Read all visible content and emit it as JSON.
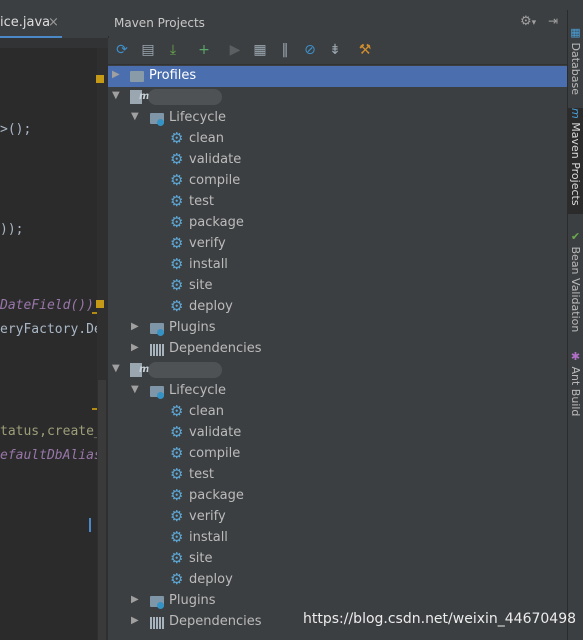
{
  "editor": {
    "tab_label": "ice.java",
    "tab_close": "×",
    "code_lines": [
      {
        "text": ">();",
        "style": "normal"
      },
      {
        "text": "));",
        "style": "normal"
      },
      {
        "text": "DateField())",
        "style": "ital"
      },
      {
        "text": "eryFactory.Der",
        "style": "normal"
      },
      {
        "text": "tatus,create_t",
        "style": "gold"
      },
      {
        "text": "efaultDbAlias)",
        "style": "ital"
      }
    ]
  },
  "panel": {
    "title": "Maven Projects",
    "settings_icon": "⚙",
    "settings_caret": "▾",
    "hide_icon": "⇥"
  },
  "toolbar": [
    {
      "name": "reimport-icon",
      "glyph": "⟳",
      "color": "#3d8fc9"
    },
    {
      "name": "generate-sources-icon",
      "glyph": "▤",
      "color": "#9aa7b0"
    },
    {
      "name": "download-icon",
      "glyph": "⤓",
      "color": "#6aa84f"
    },
    {
      "name": "add-icon",
      "glyph": "+",
      "color": "#59a869"
    },
    {
      "name": "run-icon",
      "glyph": "▶",
      "color": "#5c5f61"
    },
    {
      "name": "run-config-icon",
      "glyph": "▦",
      "color": "#9aa7b0"
    },
    {
      "name": "toggle-offline-icon",
      "glyph": "‖",
      "color": "#9aa7b0"
    },
    {
      "name": "skip-tests-icon",
      "glyph": "⊘",
      "color": "#3d8fc9"
    },
    {
      "name": "collapse-all-icon",
      "glyph": "⇟",
      "color": "#9aa7b0"
    },
    {
      "name": "maven-settings-icon",
      "glyph": "⚒",
      "color": "#d08f2d"
    }
  ],
  "tree": {
    "profiles": "Profiles",
    "projects": [
      {
        "lifecycle_label": "Lifecycle",
        "phases": [
          "clean",
          "validate",
          "compile",
          "test",
          "package",
          "verify",
          "install",
          "site",
          "deploy"
        ],
        "plugins_label": "Plugins",
        "dependencies_label": "Dependencies"
      },
      {
        "lifecycle_label": "Lifecycle",
        "phases": [
          "clean",
          "validate",
          "compile",
          "test",
          "package",
          "verify",
          "install",
          "site",
          "deploy"
        ],
        "plugins_label": "Plugins",
        "dependencies_label": "Dependencies"
      }
    ]
  },
  "sidebar": {
    "tabs": [
      "Database",
      "Maven Projects",
      "Bean Validation",
      "Ant Build"
    ]
  },
  "watermark": "https://blog.csdn.net/weixin_44670498",
  "colors": {
    "selection": "#4b6eaf",
    "panel_bg": "#3c3f41",
    "editor_bg": "#2b2b2b",
    "gear": "#5ea6d4"
  }
}
